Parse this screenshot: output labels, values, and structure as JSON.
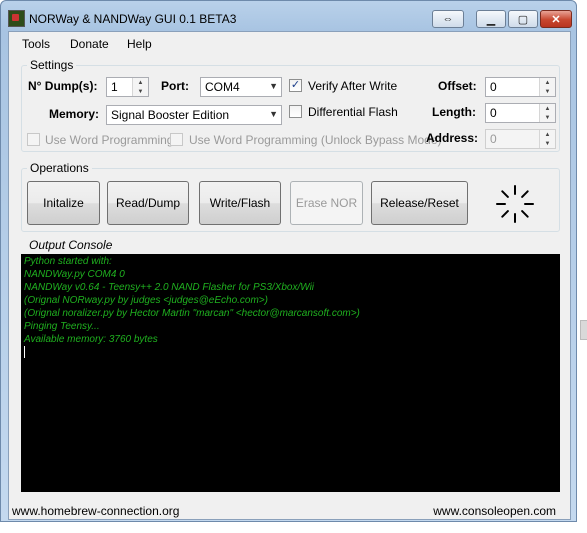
{
  "window": {
    "title": "NORWay & NANDWay GUI 0.1 BETA3"
  },
  "menu": [
    "Tools",
    "Donate",
    "Help"
  ],
  "settings": {
    "title": "Settings",
    "dump_label": "N° Dump(s):",
    "dump_value": "1",
    "port_label": "Port:",
    "port_value": "COM4",
    "verify_label": "Verify After Write",
    "verify_checked": true,
    "memory_label": "Memory:",
    "memory_value": "Signal Booster Edition",
    "differential_label": "Differential Flash",
    "differential_checked": false,
    "word_prog_label": "Use Word Programming",
    "word_prog_unlock_label": "Use Word Programming (Unlock Bypass Mode)",
    "offset_label": "Offset:",
    "offset_value": "0",
    "length_label": "Length:",
    "length_value": "0",
    "address_label": "Address:",
    "address_value": "0"
  },
  "operations": {
    "title": "Operations",
    "buttons": [
      "Initalize",
      "Read/Dump",
      "Write/Flash",
      "Erase NOR",
      "Release/Reset"
    ]
  },
  "console": {
    "title": "Output Console",
    "lines": [
      "Python started with:",
      "NANDWay.py COM4 0",
      "NANDWay v0.64 - Teensy++ 2.0 NAND Flasher for PS3/Xbox/Wii",
      "(Orignal NORway.py by judges <judges@eEcho.com>)",
      "(Orignal noralizer.py by Hector Martin \"marcan\" <hector@marcansoft.com>)",
      "Pinging Teensy...",
      "Available memory: 3760 bytes"
    ]
  },
  "footer": {
    "left": "www.homebrew-connection.org",
    "right": "www.consoleopen.com"
  },
  "colors": {
    "console_bg": "#000000",
    "console_text": "#1fb01f",
    "close_button": "#c8472f"
  },
  "icons": [
    "app-icon",
    "restore-icon",
    "minimize-icon",
    "maximize-icon",
    "close-icon",
    "loading-spinner-icon",
    "chevron-down-icon",
    "spin-up-icon",
    "spin-down-icon"
  ]
}
